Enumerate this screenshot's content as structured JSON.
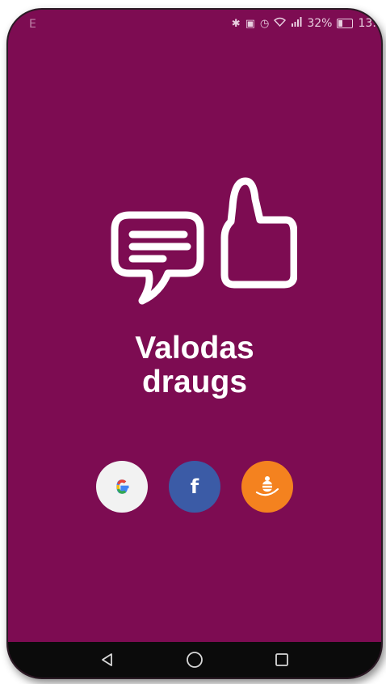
{
  "status_bar": {
    "left_text": "E",
    "battery_percent": "32%",
    "time": "13:",
    "icons": [
      "bluetooth-icon",
      "nfc-icon",
      "alarm-icon",
      "wifi-icon",
      "signal-icon",
      "battery-icon"
    ]
  },
  "logo": {
    "icons": [
      "chat-bubble-icon",
      "thumbs-up-icon"
    ]
  },
  "app": {
    "title_line1": "Valodas",
    "title_line2": "draugs"
  },
  "login": {
    "buttons": [
      {
        "name": "google",
        "icon": "google-icon",
        "color": "#f2f2f2"
      },
      {
        "name": "facebook",
        "icon": "facebook-icon",
        "label": "f",
        "color": "#3b5ba6"
      },
      {
        "name": "other",
        "icon": "bee-icon",
        "color": "#f4821f"
      }
    ]
  },
  "nav_bar": {
    "buttons": [
      "back-icon",
      "home-icon",
      "recents-icon"
    ]
  },
  "colors": {
    "background": "#7d0c52",
    "text": "#ffffff",
    "nav": "#0b0b0b"
  }
}
